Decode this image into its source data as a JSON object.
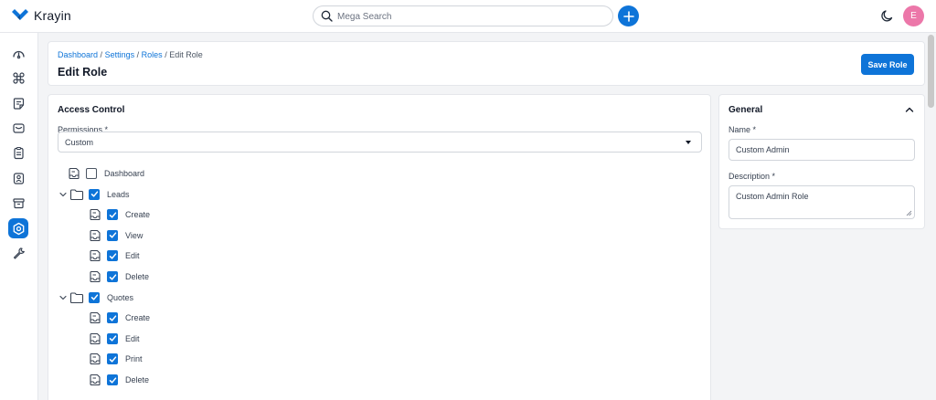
{
  "brand": {
    "name": "Krayin"
  },
  "search": {
    "placeholder": "Mega Search"
  },
  "user": {
    "avatar_initial": "E"
  },
  "breadcrumb": {
    "items": [
      "Dashboard",
      "Settings",
      "Roles"
    ],
    "current": "Edit Role",
    "separator": "/"
  },
  "page": {
    "title": "Edit Role",
    "save_label": "Save Role"
  },
  "access_control": {
    "title": "Access Control",
    "permissions_label": "Permissions *",
    "permissions_value": "Custom",
    "tree": [
      {
        "label": "Dashboard",
        "checked": false
      },
      {
        "label": "Leads",
        "checked": true,
        "expanded": true,
        "children": [
          {
            "label": "Create",
            "checked": true
          },
          {
            "label": "View",
            "checked": true
          },
          {
            "label": "Edit",
            "checked": true
          },
          {
            "label": "Delete",
            "checked": true
          }
        ]
      },
      {
        "label": "Quotes",
        "checked": true,
        "expanded": true,
        "children": [
          {
            "label": "Create",
            "checked": true
          },
          {
            "label": "Edit",
            "checked": true
          },
          {
            "label": "Print",
            "checked": true
          },
          {
            "label": "Delete",
            "checked": true
          }
        ]
      }
    ]
  },
  "general": {
    "title": "General",
    "name_label": "Name *",
    "name_value": "Custom Admin",
    "description_label": "Description *",
    "description_value": "Custom Admin Role"
  },
  "sidebar": {
    "items": [
      {
        "icon": "dashboard-icon"
      },
      {
        "icon": "leads-icon"
      },
      {
        "icon": "quotes-icon"
      },
      {
        "icon": "mail-icon"
      },
      {
        "icon": "activities-icon"
      },
      {
        "icon": "contacts-icon"
      },
      {
        "icon": "products-icon"
      },
      {
        "icon": "settings-icon",
        "active": true
      },
      {
        "icon": "configuration-icon"
      }
    ]
  },
  "colors": {
    "accent": "#0e74d8",
    "avatar": "#ec77a9",
    "background": "#f3f4f6"
  }
}
